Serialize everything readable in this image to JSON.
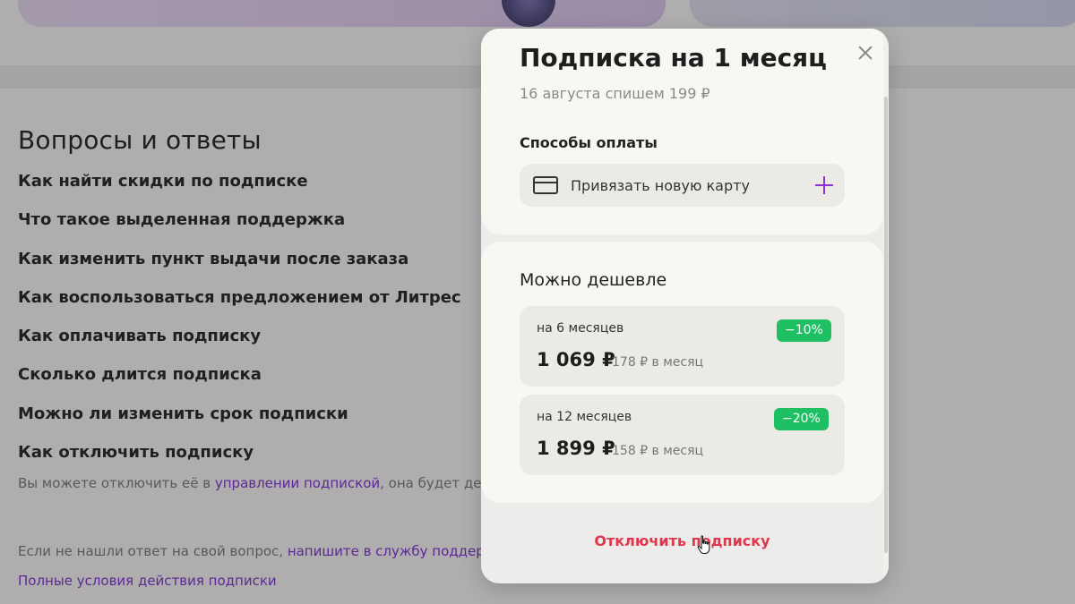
{
  "faq": {
    "title": "Вопросы и ответы",
    "questions": [
      "Как найти скидки по подписке",
      "Что такое выделенная поддержка",
      "Как изменить пункт выдачи после заказа",
      "Как воспользоваться предложением от Литрес",
      "Как оплачивать подписку",
      "Сколько длится подписка",
      "Можно ли изменить срок подписки",
      "Как отключить подписку"
    ],
    "answer_prefix": "Вы можете отключить её в ",
    "answer_link": "управлении подпиской",
    "answer_suffix": ", она будет де",
    "help_prefix": "Если не нашли ответ на свой вопрос, ",
    "help_link": "напишите в службу поддер",
    "terms_link": "Полные условия действия подписки"
  },
  "modal": {
    "title": "Подписка на 1 месяц",
    "subtitle": "16 августа спишем 199 ₽",
    "payment_label": "Способы оплаты",
    "add_card_label": "Привязать новую карту",
    "cheaper_title": "Можно дешевле",
    "offers": [
      {
        "period": "на 6 месяцев",
        "discount": "−10%",
        "price": "1 069 ₽",
        "per_month": "178 ₽ в месяц"
      },
      {
        "period": "на 12 месяцев",
        "discount": "−20%",
        "price": "1 899 ₽",
        "per_month": "158 ₽ в месяц"
      }
    ],
    "cancel_label": "Отключить подписку"
  },
  "colors": {
    "accent": "#7b2fd1",
    "discount_badge": "#1fbf63",
    "cancel": "#e0374f"
  },
  "icons": {
    "close": "close-icon",
    "card": "credit-card-icon",
    "add": "plus-icon",
    "cursor": "hand-pointer-icon"
  }
}
